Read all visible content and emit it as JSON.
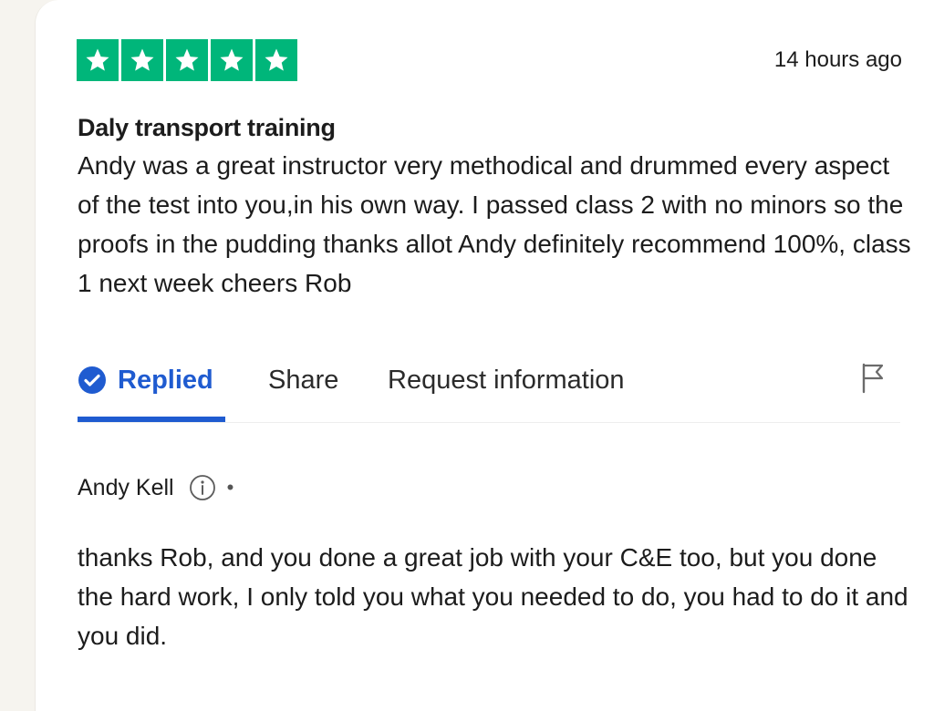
{
  "review": {
    "rating": 5,
    "rating_max": 5,
    "star_color": "#00b67a",
    "time_ago": "14 hours ago",
    "title": "Daly transport training",
    "body": "Andy was a great instructor very methodical and drummed every aspect of the test into you,in his own way. I passed class 2 with no minors so the proofs in the pudding thanks allot Andy definitely recommend 100%, class 1 next week cheers Rob"
  },
  "actions": {
    "replied_label": "Replied",
    "share_label": "Share",
    "request_label": "Request information",
    "accent_color": "#1f5bd0"
  },
  "reply": {
    "author": "Andy Kell",
    "separator": "•",
    "body": "thanks Rob, and you done a great job with your C&E too, but you done the hard work, I only told you what you needed to do, you had to do it and you did."
  },
  "icons": [
    "star-icon",
    "check-circle-icon",
    "flag-icon",
    "info-icon"
  ]
}
